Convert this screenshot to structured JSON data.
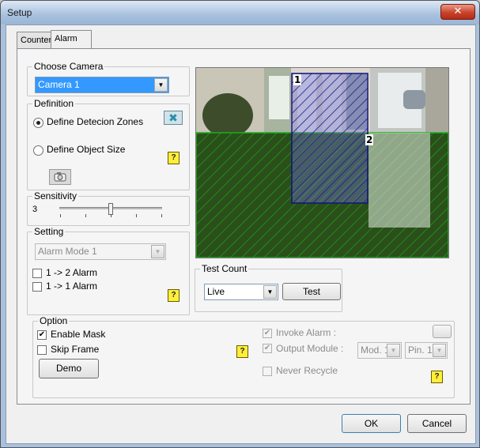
{
  "window": {
    "title": "Setup",
    "close_glyph": "✕"
  },
  "tabs": [
    {
      "label": "Counter"
    },
    {
      "label": "Alarm"
    }
  ],
  "choose_camera": {
    "legend": "Choose Camera",
    "selected": "Camera 1"
  },
  "definition": {
    "legend": "Definition",
    "option_zones": "Define Detecion Zones",
    "option_size": "Define Object Size",
    "selected_option": "zones",
    "delete_icon": "delete-zone-icon",
    "camera_icon": "camera-icon"
  },
  "sensitivity": {
    "legend": "Sensitivity",
    "value": "3",
    "level_fraction": 0.5
  },
  "setting": {
    "legend": "Setting",
    "mode": "Alarm Mode 1",
    "alarm_1_2": "1 -> 2 Alarm",
    "alarm_2_1": "1 -> 1 Alarm"
  },
  "preview": {
    "zone_1_label": "1",
    "zone_2_label": "2"
  },
  "test_count": {
    "legend": "Test Count",
    "mode": "Live",
    "test_button": "Test"
  },
  "option": {
    "legend": "Option",
    "enable_mask": "Enable Mask",
    "enable_mask_checked": true,
    "skip_frame": "Skip Frame",
    "skip_frame_checked": false,
    "demo_button": "Demo",
    "invoke_alarm": "Invoke Alarm :",
    "output_module": "Output Module :",
    "module_value": "Mod. 1",
    "pin_value": "Pin. 1",
    "never_recycle": "Never Recycle"
  },
  "footer": {
    "ok_button": "OK",
    "cancel_button": "Cancel"
  },
  "help_glyph": "?",
  "check_glyph": "✔",
  "colors": {
    "zone1": "#1c1c8c",
    "zone2": "#12a012",
    "titlebar": "#a7c1de"
  }
}
